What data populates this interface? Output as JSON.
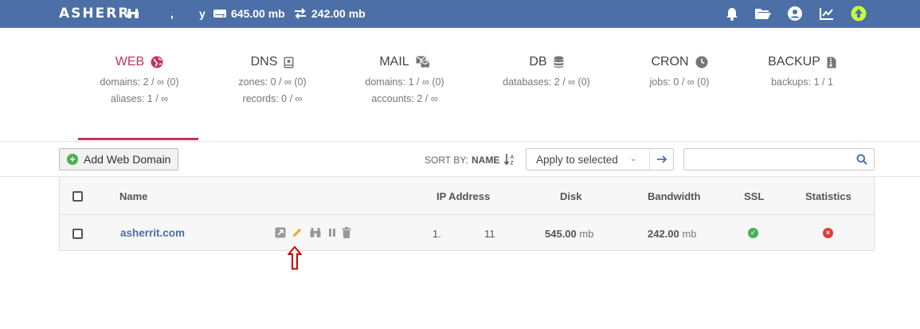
{
  "topbar": {
    "logo": "ASHERR",
    "user_fragment": ",",
    "user_suffix": "y",
    "disk_usage": "645.00 mb",
    "bandwidth_usage": "242.00 mb",
    "icons": [
      "bell-icon",
      "folder-icon",
      "user-icon",
      "chart-icon",
      "update-icon"
    ]
  },
  "stats": [
    {
      "title": "WEB",
      "icon": "globe-icon",
      "lines": [
        "domains: 2 / ∞ (0)",
        "aliases: 1 / ∞"
      ],
      "active": true
    },
    {
      "title": "DNS",
      "icon": "dns-book-icon",
      "lines": [
        "zones: 0 / ∞ (0)",
        "records: 0 / ∞"
      ]
    },
    {
      "title": "MAIL",
      "icon": "mail-icon",
      "lines": [
        "domains: 1 / ∞ (0)",
        "accounts: 2 / ∞"
      ]
    },
    {
      "title": "DB",
      "icon": "database-icon",
      "lines": [
        "databases: 2 / ∞ (0)"
      ]
    },
    {
      "title": "CRON",
      "icon": "clock-icon",
      "lines": [
        "jobs: 0 / ∞ (0)"
      ]
    },
    {
      "title": "BACKUP",
      "icon": "file-archive-icon",
      "lines": [
        "backups: 1 / 1"
      ]
    }
  ],
  "toolbar": {
    "add_label": "Add Web Domain",
    "sort_label": "SORT BY:",
    "sort_value": "NAME",
    "select_value": "Apply to selected",
    "search_placeholder": ""
  },
  "table": {
    "headers": {
      "name": "Name",
      "ip": "IP Address",
      "disk": "Disk",
      "bandwidth": "Bandwidth",
      "ssl": "SSL",
      "statistics": "Statistics"
    },
    "rows": [
      {
        "name": "asherrit.com",
        "ip_part1": "1.",
        "ip_part2": "11",
        "disk_value": "545.00",
        "disk_unit": "mb",
        "bandwidth_value": "242.00",
        "bandwidth_unit": "mb",
        "ssl": "enabled",
        "statistics": "disabled",
        "actions": [
          "open-external-icon",
          "edit-pencil-icon",
          "logs-binoculars-icon",
          "suspend-pause-icon",
          "delete-trash-icon"
        ]
      }
    ]
  },
  "colors": {
    "topbar": "#4c6fa8",
    "accent": "#c1345f",
    "link": "#4c6fa8",
    "success": "#4caf50",
    "danger": "#e53935",
    "edit": "#f5a623",
    "pointer": "#cc0000"
  }
}
